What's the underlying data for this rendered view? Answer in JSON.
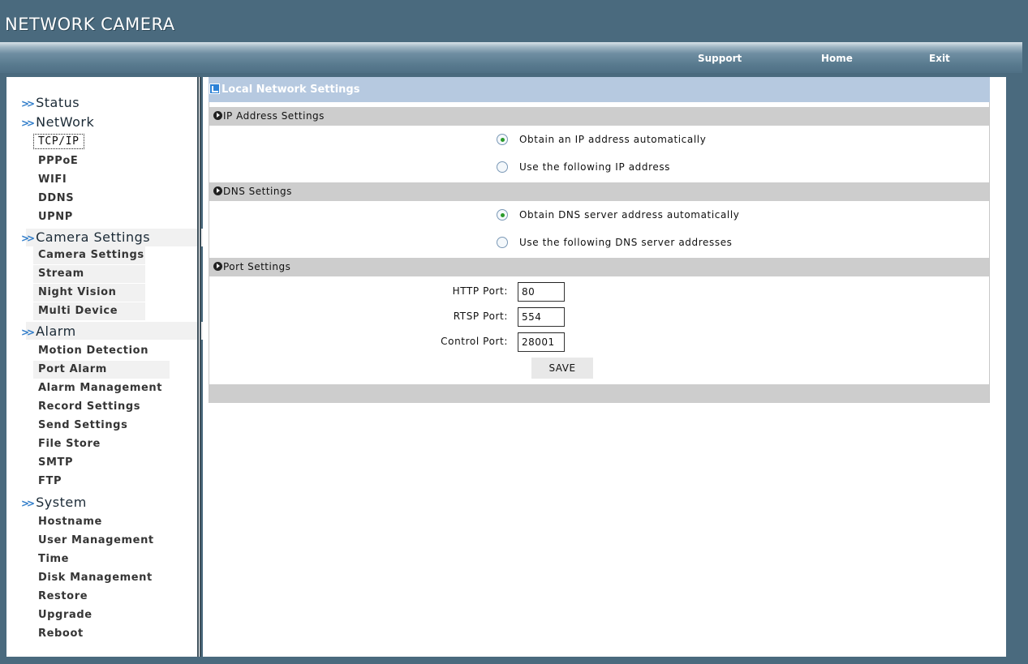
{
  "header": {
    "logo": "NETWORK CAMERA",
    "nav": [
      "Support",
      "Home",
      "Exit"
    ]
  },
  "sidebar": {
    "sections": [
      {
        "title": "Status",
        "items": []
      },
      {
        "title": "NetWork",
        "items": [
          "TCP/IP",
          "PPPoE",
          "WIFI",
          "DDNS",
          "UPNP"
        ]
      },
      {
        "title": "Camera Settings",
        "items": [
          "Camera Settings",
          "Stream",
          "Night Vision",
          "Multi Device"
        ]
      },
      {
        "title": "Alarm",
        "items": [
          "Motion Detection",
          "Port Alarm",
          "Alarm Management",
          "Record Settings",
          "Send Settings",
          "File Store",
          "SMTP",
          "FTP"
        ]
      },
      {
        "title": "System",
        "items": [
          "Hostname",
          "User Management",
          "Time",
          "Disk Management",
          "Restore",
          "Upgrade",
          "Reboot"
        ]
      }
    ],
    "active_item": "TCP/IP"
  },
  "main": {
    "title": "Local Network Settings",
    "ip_settings": {
      "heading": "IP Address Settings",
      "options": [
        "Obtain an IP address automatically",
        "Use the following IP address"
      ],
      "selected": 0
    },
    "dns_settings": {
      "heading": "DNS Settings",
      "options": [
        "Obtain DNS server address automatically",
        "Use the following DNS server addresses"
      ],
      "selected": 0
    },
    "port_settings": {
      "heading": "Port Settings",
      "http_label": "HTTP Port:",
      "http_value": "80",
      "rtsp_label": "RTSP Port:",
      "rtsp_value": "554",
      "control_label": "Control Port:",
      "control_value": "28001"
    },
    "save_label": "SAVE"
  }
}
